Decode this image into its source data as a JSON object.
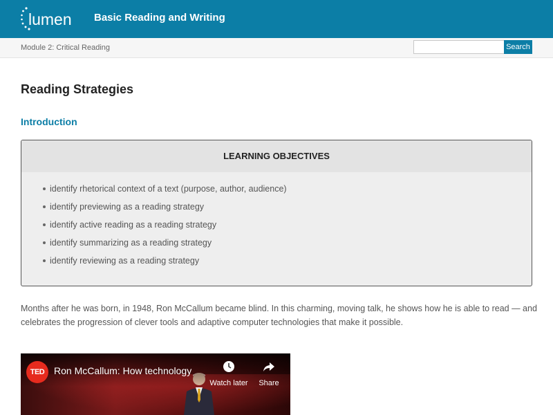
{
  "header": {
    "logo_text": "lumen",
    "course_title": "Basic Reading and Writing",
    "colors": {
      "brand": "#0c7ea6",
      "text_on_brand": "#ffffff"
    }
  },
  "subheader": {
    "module_label": "Module 2: Critical Reading",
    "search_placeholder": "",
    "search_button": "Search"
  },
  "content": {
    "page_title": "Reading Strategies",
    "section_heading": "Introduction",
    "objectives": {
      "heading": "LEARNING OBJECTIVES",
      "items": [
        "identify rhetorical context of a text (purpose, author, audience)",
        "identify previewing as a reading strategy",
        "identify active reading as a reading strategy",
        "identify summarizing as a reading strategy",
        "identify reviewing as a reading strategy"
      ]
    },
    "paragraph": "Months after he was born, in 1948, Ron McCallum became blind. In this charming, moving talk, he shows how he is able to read — and celebrates the progression of clever tools and adaptive computer technologies that make it possible."
  },
  "video": {
    "logo": "TED",
    "title": "Ron McCallum: How technology",
    "watch_later": "Watch later",
    "share": "Share",
    "icons": [
      "clock-icon",
      "share-arrow-icon"
    ]
  }
}
